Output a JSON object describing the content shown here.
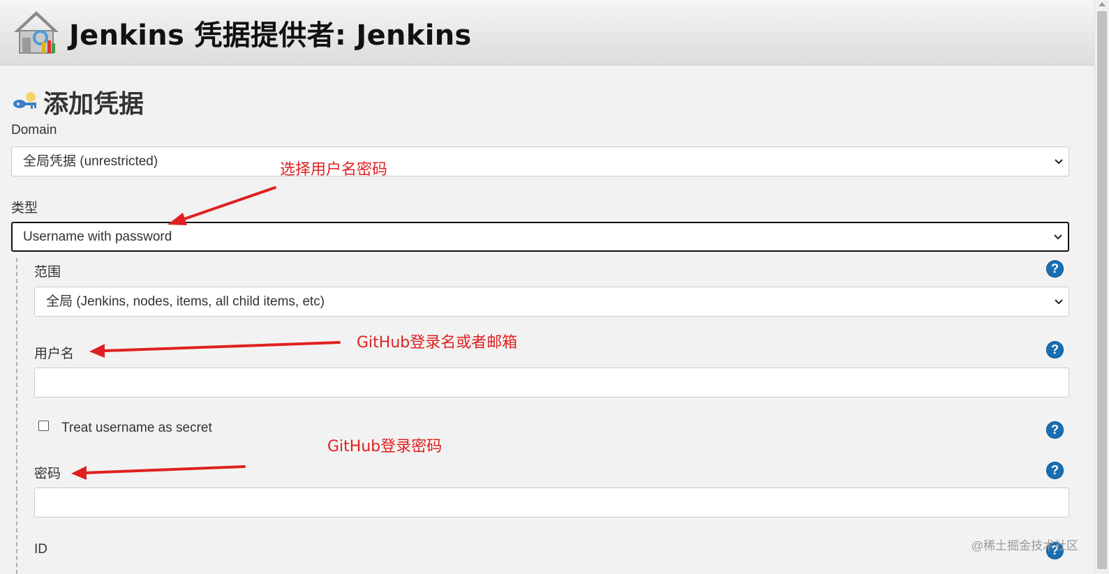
{
  "header": {
    "title": "Jenkins 凭据提供者: Jenkins"
  },
  "page": {
    "title": "添加凭据"
  },
  "form": {
    "domain": {
      "label": "Domain",
      "value": "全局凭据 (unrestricted)"
    },
    "type": {
      "label": "类型",
      "value": "Username with password"
    },
    "scope": {
      "label": "范围",
      "value": "全局 (Jenkins, nodes, items, all child items, etc)"
    },
    "username": {
      "label": "用户名",
      "value": ""
    },
    "treat_secret": {
      "label": "Treat username as secret",
      "checked": false
    },
    "password": {
      "label": "密码",
      "value": ""
    },
    "id": {
      "label": "ID"
    }
  },
  "annotations": {
    "select_type": "选择用户名密码",
    "username_hint": "GitHub登录名或者邮箱",
    "password_hint": "GitHub登录密码"
  },
  "help_icon_glyph": "?",
  "watermark": "@稀土掘金技术社区",
  "colors": {
    "annotation": "#e02020",
    "help": "#1a6fb3"
  }
}
